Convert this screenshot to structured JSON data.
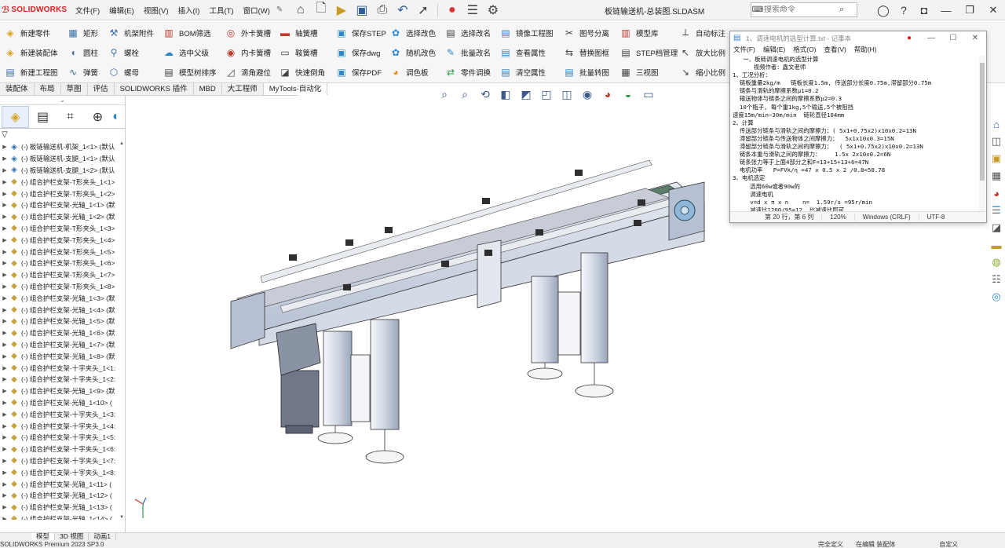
{
  "app": {
    "brand": "SOLIDWORKS",
    "menus": [
      "文件(F)",
      "编辑(E)",
      "视图(V)",
      "插入(I)",
      "工具(T)",
      "窗口(W)"
    ],
    "document_title": "板链输送机-总装图.SLDASM",
    "search_placeholder": "搜索命令"
  },
  "commands": {
    "col1": [
      "新建零件",
      "新建装配体",
      "新建工程图"
    ],
    "col2": [
      "矩形",
      "圆柱",
      "弹簧"
    ],
    "col3": [
      "机架附件",
      "螺栓",
      "螺母"
    ],
    "col4": [
      "BOM筛选",
      "选中父级",
      "模型树排序"
    ],
    "col5": [
      "外卡簧槽",
      "内卡簧槽",
      "滴角避位"
    ],
    "col6": [
      "轴簧槽",
      "鞍簧槽",
      "快速倒角"
    ],
    "col7": [
      "保存STEP",
      "保存dwg",
      "保存PDF"
    ],
    "col8": [
      "选择改色",
      "随机改色",
      "调色板"
    ],
    "col9": [
      "选择改名",
      "批量改名",
      "零件调换"
    ],
    "col10": [
      "镜像工程图",
      "查看属性",
      "清空属性"
    ],
    "col11": [
      "图号分离",
      "替换图框",
      "批量转图"
    ],
    "col12": [
      "模型库",
      "STEP档管理",
      "三视图"
    ],
    "col13": [
      "自动标注",
      "放大比例",
      "缩小比例"
    ]
  },
  "tabs": [
    "装配体",
    "布局",
    "草图",
    "评估",
    "SOLIDWORKS 插件",
    "MBD",
    "大工程师",
    "MyTools-自动化"
  ],
  "active_tab_index": 7,
  "tree": {
    "items": [
      {
        "label": "(-) 板链输送机-机架_1<1> (默认",
        "type": "asm"
      },
      {
        "label": "(-) 板链输送机-支腿_1<1> (默认",
        "type": "asm"
      },
      {
        "label": "(-) 板链输送机-支腿_1<2> (默认",
        "type": "asm"
      },
      {
        "label": "(-) 组合护栏支架-T形夹头_1<1>",
        "type": "part"
      },
      {
        "label": "(-) 组合护栏支架-T形夹头_1<2>",
        "type": "part"
      },
      {
        "label": "(-) 组合护栏支架-光轴_1<1> (默",
        "type": "part"
      },
      {
        "label": "(-) 组合护栏支架-光轴_1<2> (默",
        "type": "part"
      },
      {
        "label": "(-) 组合护栏支架-T形夹头_1<3>",
        "type": "part"
      },
      {
        "label": "(-) 组合护栏支架-T形夹头_1<4>",
        "type": "part"
      },
      {
        "label": "(-) 组合护栏支架-T形夹头_1<5>",
        "type": "part"
      },
      {
        "label": "(-) 组合护栏支架-T形夹头_1<6>",
        "type": "part"
      },
      {
        "label": "(-) 组合护栏支架-T形夹头_1<7>",
        "type": "part"
      },
      {
        "label": "(-) 组合护栏支架-T形夹头_1<8>",
        "type": "part"
      },
      {
        "label": "(-) 组合护栏支架-光轴_1<3> (默",
        "type": "part"
      },
      {
        "label": "(-) 组合护栏支架-光轴_1<4> (默",
        "type": "part"
      },
      {
        "label": "(-) 组合护栏支架-光轴_1<5> (默",
        "type": "part"
      },
      {
        "label": "(-) 组合护栏支架-光轴_1<6> (默",
        "type": "part"
      },
      {
        "label": "(-) 组合护栏支架-光轴_1<7> (默",
        "type": "part"
      },
      {
        "label": "(-) 组合护栏支架-光轴_1<8> (默",
        "type": "part"
      },
      {
        "label": "(-) 组合护栏支架-十字夹头_1<1:",
        "type": "part"
      },
      {
        "label": "(-) 组合护栏支架-十字夹头_1<2:",
        "type": "part"
      },
      {
        "label": "(-) 组合护栏支架-光轴_1<9> (默",
        "type": "part"
      },
      {
        "label": "(-) 组合护栏支架-光轴_1<10> (",
        "type": "part"
      },
      {
        "label": "(-) 组合护栏支架-十字夹头_1<3:",
        "type": "part"
      },
      {
        "label": "(-) 组合护栏支架-十字夹头_1<4:",
        "type": "part"
      },
      {
        "label": "(-) 组合护栏支架-十字夹头_1<5:",
        "type": "part"
      },
      {
        "label": "(-) 组合护栏支架-十字夹头_1<6:",
        "type": "part"
      },
      {
        "label": "(-) 组合护栏支架-十字夹头_1<7:",
        "type": "part"
      },
      {
        "label": "(-) 组合护栏支架-十字夹头_1<8:",
        "type": "part"
      },
      {
        "label": "(-) 组合护栏支架-光轴_1<11> (",
        "type": "part"
      },
      {
        "label": "(-) 组合护栏支架-光轴_1<12> (",
        "type": "part"
      },
      {
        "label": "(-) 组合护栏支架-光轴_1<13> (",
        "type": "part"
      },
      {
        "label": "(-) 组合护栏支架-光轴_1<14> (",
        "type": "part"
      }
    ]
  },
  "bottom_tabs": [
    "模型",
    "3D 视图",
    "动画1"
  ],
  "status": {
    "version": "SOLIDWORKS Premium 2023 SP3.0",
    "right": [
      "完全定义",
      "在编辑 装配体",
      "自定义"
    ]
  },
  "notepad": {
    "title": "1、调速电机的选型计算.txt - 记事本",
    "menus": [
      "文件(F)",
      "编辑(E)",
      "格式(O)",
      "查看(V)",
      "帮助(H)"
    ],
    "lines": [
      "   一、板链调速电机的选型计算",
      "      视频作者：鑫文老师",
      "1、工况分析：",
      "  链板重量2kg/m   链板长度1.5m, 传送部分长度0.75m,滞留部分0.75m",
      "  链条与滑轨的摩擦系数μ1=0.2",
      "  输送物体与链条之间的摩擦系数μ2=0.3",
      "  10个瓶子, 每个重1kg,5个输送,5个被阻挡",
      "速度15m/min~30m/min  链轮直径104mm",
      "2、计算",
      "  传送部分链条与滑轨之间的摩擦力：( 5x1+0.75x2)x10x0.2=13N",
      "  滞留部分链条与传送物体之间摩擦力：  5x1x10x0.3=15N",
      "  滞留部分链条与滑轨之间的摩擦力：  ( 5x1+0.75x2)x10x0.2=13N",
      "  链条本重与滑轨之间的摩擦力：    1.5x 2x10x0.2=6N",
      "  链条张力等于上面4部分之和F=13+15+13+6=47N",
      "  电机功率   P=FVk/η =47 x 0.5 x 2 /0.8=58.78",
      "3、电机选定",
      "     选用60w或者90w的",
      "     调速电机",
      "     v=d x π x n    n=  1.59r/s =95r/min",
      "     减速比1200/95=12  比减速比即可"
    ],
    "status": [
      "第 20 行，第 6 列",
      "120%",
      "Windows (CRLF)",
      "UTF-8"
    ]
  }
}
